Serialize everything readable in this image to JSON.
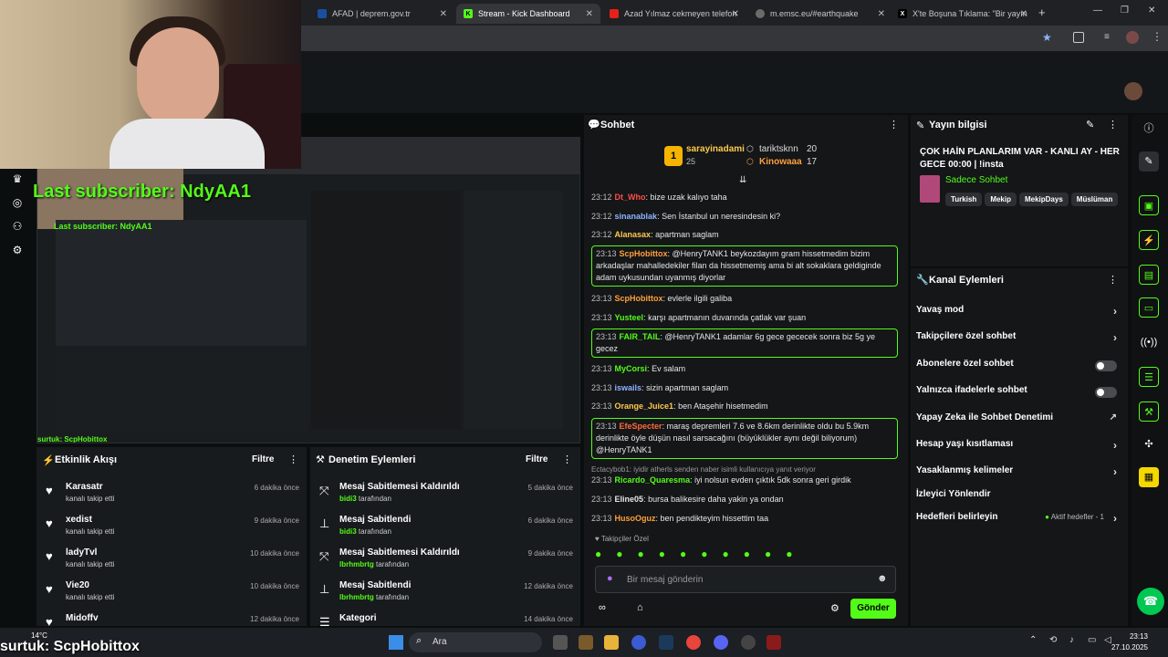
{
  "browser": {
    "tabs": [
      {
        "label": "AFAD | deprem.gov.tr",
        "color": "#1a4fa0"
      },
      {
        "label": "Stream - Kick Dashboard",
        "color": "#53fc18"
      },
      {
        "label": "Azad Yılmaz cekmeyen telefon",
        "color": "#e62117"
      },
      {
        "label": "m.emsc.eu/#earthquake",
        "color": "#6b6b6b"
      },
      {
        "label": "X'te Boşuna Tıklama: \"Bir yayın",
        "color": "#000000"
      }
    ]
  },
  "overlay": {
    "last_subscriber": "Last subscriber: NdyAA1",
    "bottom_text": "surtuk: ScpHobittox"
  },
  "activity": {
    "title": "Etkinlik Akışı",
    "filter": "Filtre",
    "items": [
      {
        "name": "Karasatr",
        "sub": "kanalı takip etti",
        "time": "6 dakika önce"
      },
      {
        "name": "xedist",
        "sub": "kanalı takip etti",
        "time": "9 dakika önce"
      },
      {
        "name": "ladyTvl",
        "sub": "kanalı takip etti",
        "time": "10 dakika önce"
      },
      {
        "name": "Vie20",
        "sub": "kanalı takip etti",
        "time": "10 dakika önce"
      },
      {
        "name": "Midoffv",
        "sub": "",
        "time": "12 dakika önce"
      }
    ]
  },
  "moderation": {
    "title": "Denetim Eylemleri",
    "filter": "Filtre",
    "items": [
      {
        "name": "Mesaj Sabitlemesi Kaldırıldı",
        "by": "bidi3",
        "suffix": "tarafından",
        "time": "5 dakika önce"
      },
      {
        "name": "Mesaj Sabitlendi",
        "by": "bidi3",
        "suffix": "tarafından",
        "time": "6 dakika önce"
      },
      {
        "name": "Mesaj Sabitlemesi Kaldırıldı",
        "by": "lbrhmbrtg",
        "suffix": "tarafından",
        "time": "9 dakika önce"
      },
      {
        "name": "Mesaj Sabitlendi",
        "by": "lbrhmbrtg",
        "suffix": "tarafından",
        "time": "12 dakika önce"
      },
      {
        "name": "Kategori",
        "by": "",
        "suffix": "",
        "time": "14 dakika önce"
      }
    ]
  },
  "chat": {
    "title": "Sohbet",
    "leaders": [
      {
        "rank": "1",
        "name": "sarayinadami",
        "count": "25"
      },
      {
        "name": "tariktsknn",
        "count": "20"
      },
      {
        "name": "Kinowaaa",
        "count": "17"
      }
    ],
    "messages": [
      {
        "ts": "23:12",
        "user": "Dt_Who",
        "color": "#ff4b4b",
        "text": "bize uzak kalıyo taha",
        "hl": false
      },
      {
        "ts": "23:12",
        "user": "sinanablak",
        "color": "#8fb4ff",
        "text": "Sen İstanbul un neresindesin ki?",
        "hl": false
      },
      {
        "ts": "23:12",
        "user": "Alanasax",
        "color": "#ffc94d",
        "text": "apartman saglam",
        "hl": false
      },
      {
        "ts": "23:13",
        "user": "ScpHobittox",
        "color": "#ff9f3a",
        "text": "@HenryTANK1 beykozdayım gram hissetmedim bizim arkadaşlar mahalledekiler filan da hissetmemiş ama bi alt sokaklara geldiginde adam uykusundan uyanmış diyorlar",
        "hl": true
      },
      {
        "ts": "23:13",
        "user": "ScpHobittox",
        "color": "#ff9f3a",
        "text": "evlerle ilgili galiba",
        "hl": false
      },
      {
        "ts": "23:13",
        "user": "Yusteel",
        "color": "#53fc18",
        "text": "karşı apartmanın duvarında çatlak var şuan",
        "hl": false
      },
      {
        "ts": "23:13",
        "user": "FAIR_TAIL",
        "color": "#53fc18",
        "text": "@HenryTANK1 adamlar 6g gece gececek sonra biz 5g ye gecez",
        "hl": true
      },
      {
        "ts": "23:13",
        "user": "MyCorsi",
        "color": "#53fc18",
        "text": "Ev salam",
        "hl": false
      },
      {
        "ts": "23:13",
        "user": "iswails",
        "color": "#8fb4ff",
        "text": "sizin apartman saglam",
        "hl": false
      },
      {
        "ts": "23:13",
        "user": "Orange_Juice1",
        "color": "#ffc94d",
        "text": "ben Ataşehir hisetmedim",
        "hl": false
      },
      {
        "ts": "23:13",
        "user": "EfeSpecter",
        "color": "#ff6b3a",
        "text": "maraş depremleri 7.6 ve 8.6km derinlikte oldu bu 5.9km derinlikte öyle düşün nasıl sarsacağını (büyüklükler aynı değil biliyorum) @HenryTANK1",
        "hl": true
      },
      {
        "ts": "23:13",
        "user": "Ricardo_Quaresma",
        "color": "#53fc18",
        "text": "iyi nolsun evden çıktık 5dk sonra geri girdik",
        "hl": false
      },
      {
        "ts": "23:13",
        "user": "Eline05",
        "color": "#e6e6e6",
        "text": "bursa balikesire daha yakin ya ondan",
        "hl": false
      },
      {
        "ts": "23:13",
        "user": "HusoOguz",
        "color": "#ff9f3a",
        "text": "ben pendikteyim hissettim taa",
        "hl": false
      }
    ],
    "reply_hint": "Ectacybob1: iyidir atherls senden naber isimli kullanıcıya yanıt veriyor",
    "followers_only": "Takipçiler Özel",
    "input_placeholder": "Bir mesaj gönderin",
    "send": "Gönder"
  },
  "stream_info": {
    "title": "Yayın bilgisi",
    "stream_title": "ÇOK HAİN PLANLARIM VAR - KANLI AY - HER GECE 00:00 | !insta",
    "category": "Sadece Sohbet",
    "tags": [
      "Turkish",
      "Mekip",
      "MekipDays",
      "Müslüman"
    ]
  },
  "channel_actions": {
    "title": "Kanal Eylemleri",
    "items": [
      {
        "label": "Yavaş mod",
        "kind": "chevron"
      },
      {
        "label": "Takipçilere özel sohbet",
        "kind": "chevron"
      },
      {
        "label": "Abonelere özel sohbet",
        "kind": "toggle"
      },
      {
        "label": "Yalnızca ifadelerle sohbet",
        "kind": "toggle"
      },
      {
        "label": "Yapay Zeka ile Sohbet Denetimi",
        "kind": "external"
      },
      {
        "label": "Hesap yaşı kısıtlaması",
        "kind": "chevron"
      },
      {
        "label": "Yasaklanmış kelimeler",
        "kind": "chevron"
      },
      {
        "label": "İzleyici Yönlendir",
        "kind": "none"
      },
      {
        "label": "Hedefleri belirleyin",
        "kind": "chevron"
      }
    ],
    "goals_status": "Aktif hedefler - 1"
  },
  "taskbar": {
    "weather": "14°C",
    "search": "Ara",
    "time": "23:13",
    "date": "27.10.2025"
  }
}
